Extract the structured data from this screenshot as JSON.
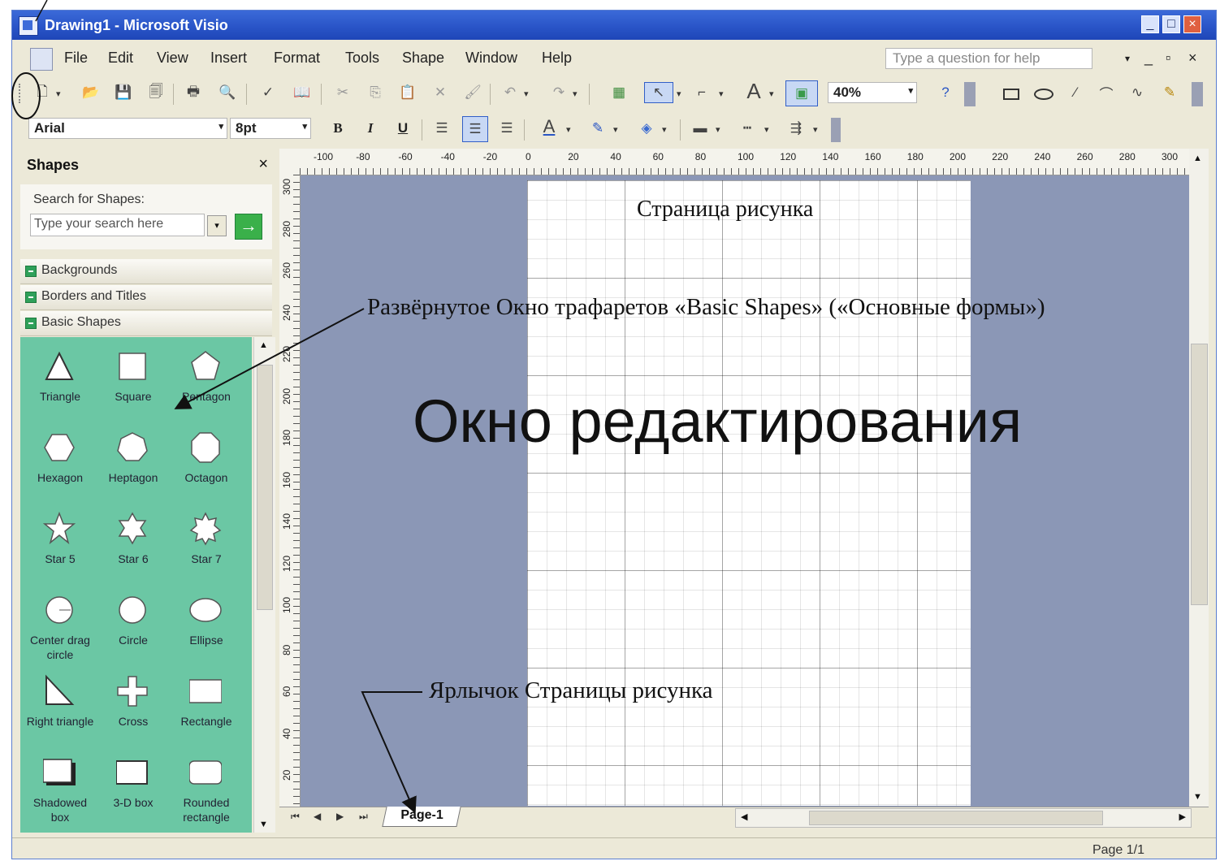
{
  "window": {
    "title": "Drawing1 - Microsoft Visio",
    "controls": [
      "_",
      "□",
      "×"
    ]
  },
  "menubar": {
    "items": [
      "File",
      "Edit",
      "View",
      "Insert",
      "Format",
      "Tools",
      "Shape",
      "Window",
      "Help"
    ],
    "help_placeholder": "Type a question for help",
    "doc_controls": [
      "▾",
      "_",
      "▫",
      "×"
    ]
  },
  "standard_toolbar": {
    "zoom": "40%"
  },
  "format_toolbar": {
    "font": "Arial",
    "size": "8pt",
    "bold": "B",
    "italic": "I",
    "underline": "U"
  },
  "shapes_window": {
    "title": "Shapes",
    "close": "×",
    "search_label": "Search for Shapes:",
    "search_placeholder": "Type your search here",
    "go": "→",
    "stencils": [
      "Backgrounds",
      "Borders and Titles",
      "Basic Shapes"
    ],
    "masters": [
      {
        "name": "Triangle",
        "icon": "triangle-icon"
      },
      {
        "name": "Square",
        "icon": "square-icon"
      },
      {
        "name": "Pentagon",
        "icon": "pentagon-icon"
      },
      {
        "name": "Hexagon",
        "icon": "hexagon-icon"
      },
      {
        "name": "Heptagon",
        "icon": "heptagon-icon"
      },
      {
        "name": "Octagon",
        "icon": "octagon-icon"
      },
      {
        "name": "Star 5",
        "icon": "star5-icon"
      },
      {
        "name": "Star 6",
        "icon": "star6-icon"
      },
      {
        "name": "Star 7",
        "icon": "star7-icon"
      },
      {
        "name": "Center drag circle",
        "icon": "center-drag-circle-icon"
      },
      {
        "name": "Circle",
        "icon": "circle-icon"
      },
      {
        "name": "Ellipse",
        "icon": "ellipse-icon"
      },
      {
        "name": "Right triangle",
        "icon": "right-triangle-icon"
      },
      {
        "name": "Cross",
        "icon": "cross-icon"
      },
      {
        "name": "Rectangle",
        "icon": "rectangle-icon"
      },
      {
        "name": "Shadowed box",
        "icon": "shadowed-box-icon"
      },
      {
        "name": "3-D box",
        "icon": "3d-box-icon"
      },
      {
        "name": "Rounded rectangle",
        "icon": "rounded-rectangle-icon"
      }
    ]
  },
  "rulers": {
    "horizontal": [
      "-100",
      "-80",
      "-60",
      "-40",
      "-20",
      "0",
      "20",
      "40",
      "60",
      "80",
      "100",
      "120",
      "140",
      "160",
      "180",
      "200",
      "220",
      "240",
      "260",
      "280",
      "300"
    ],
    "vertical": [
      "300",
      "280",
      "260",
      "240",
      "220",
      "200",
      "180",
      "160",
      "140",
      "120",
      "100",
      "80",
      "60",
      "40",
      "20"
    ]
  },
  "page_tab": "Page-1",
  "status": {
    "page": "Page 1/1"
  },
  "annotations": {
    "drawing_page": "Страница рисунка",
    "stencil_window": "Развёрнутое Окно трафаретов «Basic Shapes» («Основные формы»)",
    "editing_window": "Окно редактирования",
    "page_tab": "Ярлычок Страницы рисунка"
  },
  "colors": {
    "titlebar": "#2a55c8",
    "stencil_bg": "#6bc7a4",
    "canvas_bg": "#8b97b6",
    "page_bg": "#ffffff"
  }
}
